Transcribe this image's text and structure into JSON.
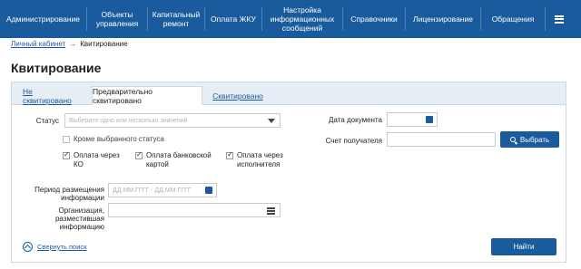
{
  "nav": {
    "items": [
      "Администрирование",
      "Объекты управления",
      "Капитальный ремонт",
      "Оплата ЖКУ",
      "Настройка информационных сообщений",
      "Справочники",
      "Лицензирование",
      "Обращения"
    ],
    "menu_icon": "hamburger-icon"
  },
  "breadcrumb": {
    "home": "Личный кабинет",
    "arrow": "→",
    "current": "Квитирование"
  },
  "page": {
    "title": "Квитирование"
  },
  "tabs": [
    "Не сквитировано",
    "Предварительно сквитировано",
    "Сквитировано"
  ],
  "form": {
    "status_label": "Статус",
    "status_placeholder": "Выберите одно или несколько значений",
    "except_status_label": "Кроме выбранного статуса",
    "pay_ko_label": "Оплата через КО",
    "pay_card_label": "Оплата банковской картой",
    "pay_exec_label": "Оплата через исполнителя",
    "period_label": "Период размещения информации",
    "period_placeholder": "ДД.ММ.ГГГГ  -  ДД.ММ.ГГГГ",
    "org_label": "Организация, разместившая информацию",
    "date_label": "Дата документа",
    "account_label": "Счет получателя",
    "select_button": "Выбрать",
    "collapse_label": "Свернуть поиск",
    "find_button": "Найти"
  },
  "colors": {
    "accent": "#1a5b9e",
    "tabbar": "#e6edf5"
  }
}
